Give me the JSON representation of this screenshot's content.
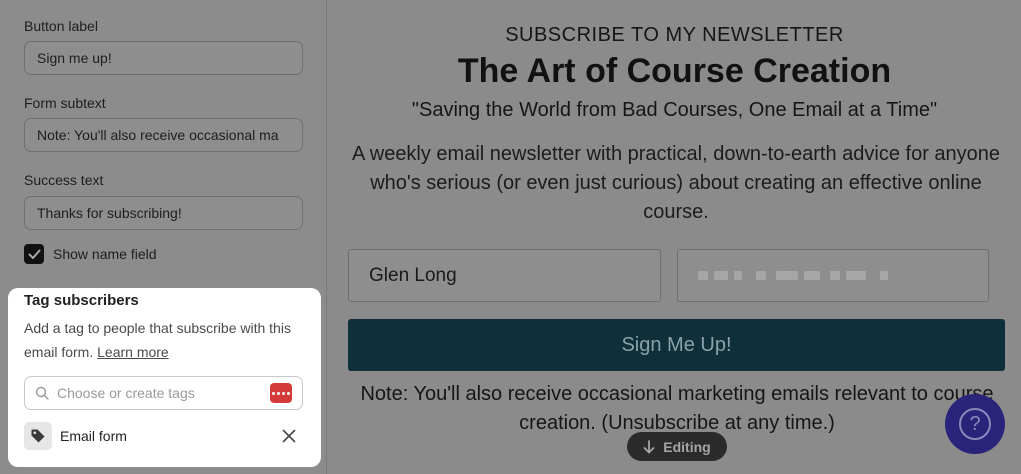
{
  "settings": {
    "button_label": {
      "label": "Button label",
      "value": "Sign me up!"
    },
    "form_subtext": {
      "label": "Form subtext",
      "value": "Note: You'll also receive occasional ma"
    },
    "success_text": {
      "label": "Success text",
      "value": "Thanks for subscribing!"
    },
    "show_name_field": {
      "label": "Show name field",
      "checked": true
    }
  },
  "tags_panel": {
    "title": "Tag subscribers",
    "description": "Add a tag to people that subscribe with this email form.",
    "learn_more": "Learn more",
    "search_placeholder": "Choose or create tags",
    "selected_tag": "Email form"
  },
  "preview": {
    "eyebrow": "SUBSCRIBE TO MY NEWSLETTER",
    "title": "The Art of Course Creation",
    "quote": "\"Saving the World from Bad Courses, One Email at a Time\"",
    "description": "A weekly email newsletter with practical, down-to-earth advice for anyone who's serious (or even just curious) about creating an effective online course.",
    "name_value": "Glen Long",
    "button_label": "Sign Me Up!",
    "note": "Note: You'll also receive occasional marketing emails relevant to course creation. (Unsubscribe at any time.)",
    "editing_label": "Editing"
  },
  "help": {
    "icon_label": "?"
  },
  "colors": {
    "overlay": "#8b8b8b",
    "button_dark": "#0f2f3a",
    "help_purple": "#2a237a",
    "badge_red": "#d53a3a"
  },
  "icons": [
    "search-icon",
    "tag-icon",
    "close-icon",
    "checkmark-icon",
    "arrow-down-icon",
    "help-icon"
  ]
}
